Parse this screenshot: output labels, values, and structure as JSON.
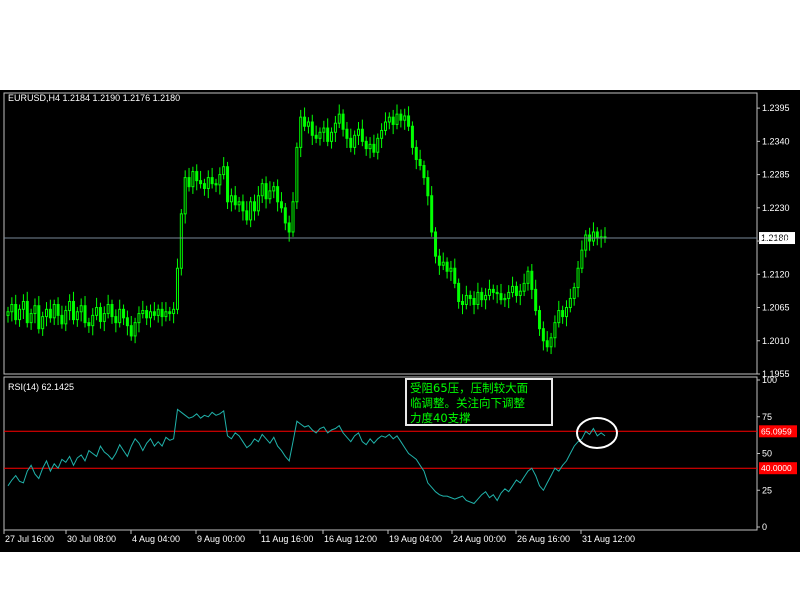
{
  "header": {
    "symbol": "EURUSD,H4",
    "ohlc": "1.2184 1.2190 1.2176 1.2180"
  },
  "indicator": {
    "name": "RSI(14)",
    "value": "62.1425"
  },
  "annotation": {
    "line1": "受阻65压，压制较大面",
    "line2": "临调整。关注向下调整",
    "line3": "力度40支撑"
  },
  "colors": {
    "background": "#000000",
    "up_candle": "#00ff00",
    "rsi_line": "#20b2aa",
    "level_line": "#ff0000",
    "price_line": "#778899",
    "annotation_text": "#00ff00"
  },
  "chart_data": [
    {
      "type": "candlestick",
      "series": "EURUSD H4",
      "ylim": [
        1.1955,
        1.242
      ],
      "price_ticks": [
        1.2395,
        1.234,
        1.2285,
        1.223,
        1.2175,
        1.212,
        1.2065,
        1.201,
        1.1955
      ],
      "current_price": "1.2180",
      "x_labels": [
        "27 Jul 16:00",
        "30 Jul 08:00",
        "4 Aug 04:00",
        "9 Aug 00:00",
        "11 Aug 16:00",
        "16 Aug 12:00",
        "19 Aug 04:00",
        "24 Aug 00:00",
        "26 Aug 16:00",
        "31 Aug 12:00"
      ],
      "close": [
        1.2058,
        1.207,
        1.2045,
        1.2062,
        1.2075,
        1.204,
        1.2055,
        1.2068,
        1.203,
        1.205,
        1.2062,
        1.2048,
        1.207,
        1.2052,
        1.2038,
        1.206,
        1.2075,
        1.2045,
        1.2058,
        1.2068,
        1.204,
        1.2035,
        1.2052,
        1.2065,
        1.2042,
        1.2055,
        1.207,
        1.205,
        1.204,
        1.2062,
        1.2048,
        1.2035,
        1.2018,
        1.204,
        1.2055,
        1.206,
        1.2048,
        1.2058,
        1.2052,
        1.2062,
        1.205,
        1.2058,
        1.2055,
        1.2062,
        1.213,
        1.222,
        1.228,
        1.2265,
        1.229,
        1.2275,
        1.227,
        1.2262,
        1.228,
        1.227,
        1.2268,
        1.2285,
        1.2298,
        1.224,
        1.225,
        1.2235,
        1.224,
        1.2225,
        1.221,
        1.224,
        1.2225,
        1.225,
        1.227,
        1.2245,
        1.2258,
        1.2265,
        1.224,
        1.223,
        1.2205,
        1.219,
        1.224,
        1.233,
        1.238,
        1.2365,
        1.2372,
        1.235,
        1.2345,
        1.2355,
        1.2362,
        1.234,
        1.2355,
        1.237,
        1.2385,
        1.236,
        1.2345,
        1.233,
        1.235,
        1.236,
        1.234,
        1.2328,
        1.2335,
        1.2322,
        1.2345,
        1.2358,
        1.2372,
        1.238,
        1.2368,
        1.2385,
        1.2375,
        1.2382,
        1.2365,
        1.233,
        1.231,
        1.23,
        1.228,
        1.225,
        1.219,
        1.215,
        1.2135,
        1.214,
        1.2125,
        1.213,
        1.2105,
        1.2075,
        1.207,
        1.2085,
        1.208,
        1.207,
        1.209,
        1.2078,
        1.2085,
        1.2095,
        1.209,
        1.2088,
        1.2078,
        1.208,
        1.209,
        1.21,
        1.2085,
        1.2092,
        1.2105,
        1.2125,
        1.2095,
        1.206,
        1.203,
        1.201,
        1.2,
        1.2015,
        1.204,
        1.206,
        1.205,
        1.2065,
        1.208,
        1.2098,
        1.213,
        1.216,
        1.2185,
        1.2175,
        1.219,
        1.218,
        1.2182,
        1.218
      ],
      "rsi": {
        "ylim": [
          0,
          100
        ],
        "ticks": [
          100,
          75,
          50,
          25,
          0
        ],
        "levels": [
          "65.0959",
          "40.0000"
        ],
        "level_values": [
          65.0959,
          40.0
        ],
        "values": [
          28,
          32,
          35,
          31,
          30,
          38,
          42,
          36,
          33,
          40,
          45,
          38,
          43,
          40,
          46,
          44,
          48,
          42,
          47,
          49,
          45,
          52,
          50,
          48,
          55,
          51,
          49,
          46,
          50,
          56,
          52,
          48,
          55,
          60,
          57,
          52,
          57,
          60,
          55,
          58,
          55,
          61,
          59,
          60,
          80,
          78,
          76,
          74,
          75,
          77,
          74,
          76,
          75,
          78,
          76,
          77,
          79,
          62,
          60,
          64,
          62,
          58,
          54,
          56,
          60,
          58,
          63,
          60,
          57,
          61,
          55,
          52,
          48,
          45,
          58,
          72,
          70,
          68,
          69,
          66,
          64,
          67,
          68,
          64,
          66,
          67,
          69,
          64,
          61,
          58,
          62,
          64,
          58,
          56,
          60,
          57,
          60,
          62,
          61,
          63,
          60,
          62,
          58,
          54,
          50,
          48,
          46,
          42,
          38,
          30,
          27,
          24,
          22,
          21,
          21,
          20,
          19,
          20,
          21,
          18,
          17,
          16,
          19,
          22,
          24,
          20,
          22,
          18,
          23,
          26,
          24,
          28,
          32,
          30,
          34,
          38,
          40,
          35,
          28,
          25,
          30,
          35,
          40,
          38,
          42,
          45,
          50,
          55,
          58,
          60,
          65,
          63,
          67,
          62,
          64,
          62
        ]
      }
    }
  ]
}
